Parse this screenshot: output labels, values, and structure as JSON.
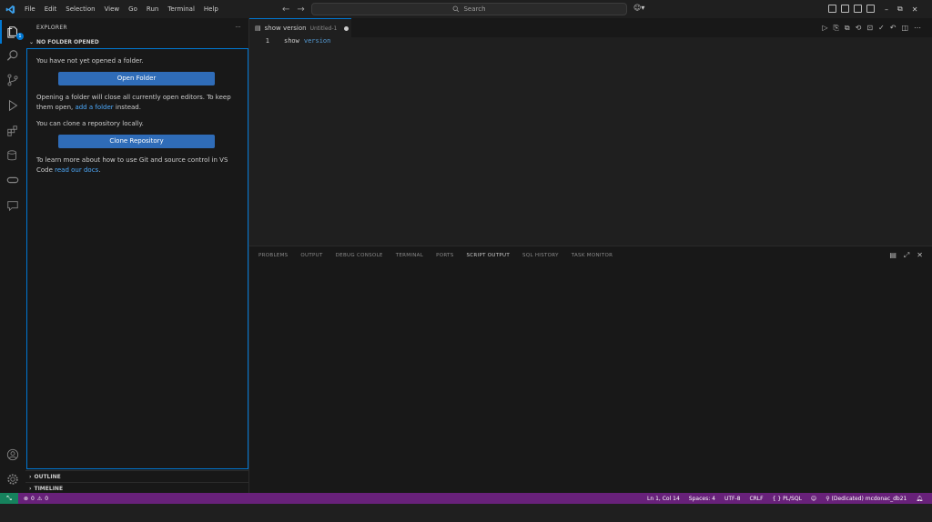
{
  "menu": [
    "File",
    "Edit",
    "Selection",
    "View",
    "Go",
    "Run",
    "Terminal",
    "Help"
  ],
  "search": {
    "label": "Search"
  },
  "sidebar": {
    "title": "EXPLORER",
    "more": "···",
    "section": "NO FOLDER OPENED",
    "msg1": "You have not yet opened a folder.",
    "open_folder": "Open Folder",
    "msg2_pre": "Opening a folder will close all currently open editors. To keep them open, ",
    "msg2_link": "add a folder",
    "msg2_post": " instead.",
    "msg3": "You can clone a repository locally.",
    "clone_repo": "Clone Repository",
    "msg4": "To learn more about how to use Git and source control in VS Code ",
    "msg4_link": "read our docs",
    "msg4_post": ".",
    "outline": "OUTLINE",
    "timeline": "TIMELINE"
  },
  "activity": {
    "badge": "1"
  },
  "editor": {
    "tab_label": "show version",
    "tab_desc": "Untitled-1",
    "line_number": "1",
    "code_kw": "show",
    "code_id": "version"
  },
  "panel": {
    "tabs": [
      "PROBLEMS",
      "OUTPUT",
      "DEBUG CONSOLE",
      "TERMINAL",
      "PORTS",
      "SCRIPT OUTPUT",
      "SQL HISTORY",
      "TASK MONITOR"
    ],
    "active_tab": "SCRIPT OUTPUT"
  },
  "status": {
    "errors": "0",
    "warnings": "0",
    "position": "Ln 1, Col 14",
    "spaces": "Spaces: 4",
    "encoding": "UTF-8",
    "eol": "CRLF",
    "language": "PL/SQL",
    "connection": "(Dedicated) mcdonac_db21"
  },
  "colors": {
    "accent": "#0078d4",
    "statusbar": "#68217a",
    "remote": "#16825d",
    "link": "#4daafc"
  }
}
